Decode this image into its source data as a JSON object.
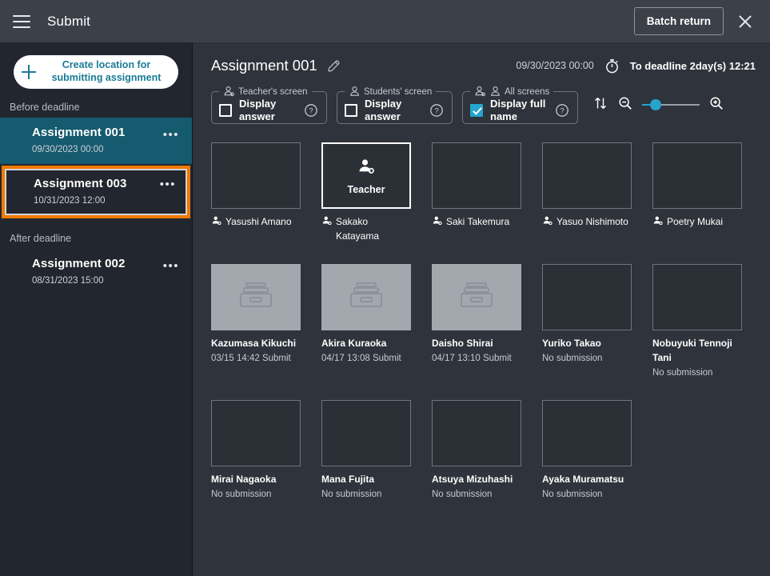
{
  "topbar": {
    "menu_icon": "hamburger-icon",
    "title": "Submit",
    "batch_return_label": "Batch return",
    "close_icon": "close-icon"
  },
  "sidebar": {
    "create_button_label": "Create location for submitting assignment",
    "groups": [
      {
        "label": "Before deadline",
        "items": [
          {
            "title": "Assignment 001",
            "date": "09/30/2023 00:00",
            "state": "selected",
            "menu": "•••"
          },
          {
            "title": "Assignment 003",
            "date": "10/31/2023 12:00",
            "state": "highlight",
            "menu": "•••"
          }
        ]
      },
      {
        "label": "After deadline",
        "items": [
          {
            "title": "Assignment 002",
            "date": "08/31/2023 15:00",
            "state": "normal",
            "menu": "•••"
          }
        ]
      }
    ]
  },
  "main": {
    "heading": "Assignment 001",
    "edit_icon": "pencil-icon",
    "date": "09/30/2023 00:00",
    "timer_icon": "stopwatch-icon",
    "deadline": "To deadline 2day(s) 12:21",
    "controls": [
      {
        "legend": "Teacher's screen",
        "legend_icon": "teacher-person-icon",
        "label": "Display answer",
        "checked": false,
        "help_icon": "question-icon"
      },
      {
        "legend": "Students' screen",
        "legend_icon": "person-icon",
        "label": "Display answer",
        "checked": false,
        "help_icon": "question-icon"
      },
      {
        "legend": "All screens",
        "legend_icon": "teacher-and-person-icon",
        "label": "Display full name",
        "checked": true,
        "help_icon": "question-icon"
      }
    ],
    "tools": {
      "sort_icon": "sort-updown-icon",
      "zoom_out_icon": "zoom-out-icon",
      "zoom_in_icon": "zoom-in-icon",
      "slider_value": 25
    },
    "teacher_label": "Teacher",
    "students": [
      {
        "name": "Yasushi Amano",
        "status": "",
        "thumb": "empty",
        "icon": "person-icon"
      },
      {
        "name": "Sakako Katayama",
        "status": "",
        "thumb": "teacher",
        "icon": "person-icon"
      },
      {
        "name": "Saki Takemura",
        "status": "",
        "thumb": "empty",
        "icon": "person-icon"
      },
      {
        "name": "Yasuo Nishimoto",
        "status": "",
        "thumb": "empty",
        "icon": "person-icon"
      },
      {
        "name": "Poetry Mukai",
        "status": "",
        "thumb": "empty",
        "icon": "person-icon"
      },
      {
        "name": "Kazumasa Kikuchi",
        "status": "03/15 14:42 Submit",
        "thumb": "submitted",
        "icon": ""
      },
      {
        "name": "Akira Kuraoka",
        "status": "04/17 13:08 Submit",
        "thumb": "submitted",
        "icon": ""
      },
      {
        "name": "Daisho Shirai",
        "status": "04/17 13:10 Submit",
        "thumb": "submitted",
        "icon": ""
      },
      {
        "name": "Yuriko Takao",
        "status": "No submission",
        "thumb": "empty",
        "icon": ""
      },
      {
        "name": "Nobuyuki Tennoji Tani",
        "status": "No submission",
        "thumb": "empty",
        "icon": ""
      },
      {
        "name": "Mirai Nagaoka",
        "status": "No submission",
        "thumb": "empty",
        "icon": ""
      },
      {
        "name": "Mana Fujita",
        "status": "No submission",
        "thumb": "empty",
        "icon": ""
      },
      {
        "name": "Atsuya Mizuhashi",
        "status": "No submission",
        "thumb": "empty",
        "icon": ""
      },
      {
        "name": "Ayaka Muramatsu",
        "status": "No submission",
        "thumb": "empty",
        "icon": ""
      }
    ]
  },
  "colors": {
    "accent_cyan": "#25a5cc",
    "highlight_orange": "#f07800",
    "selected_teal": "#155a6e",
    "panel_bg": "#2f333b",
    "sidebar_bg": "#22262e",
    "topbar_bg": "#3b4049",
    "thumb_gray": "#a3a8af"
  }
}
